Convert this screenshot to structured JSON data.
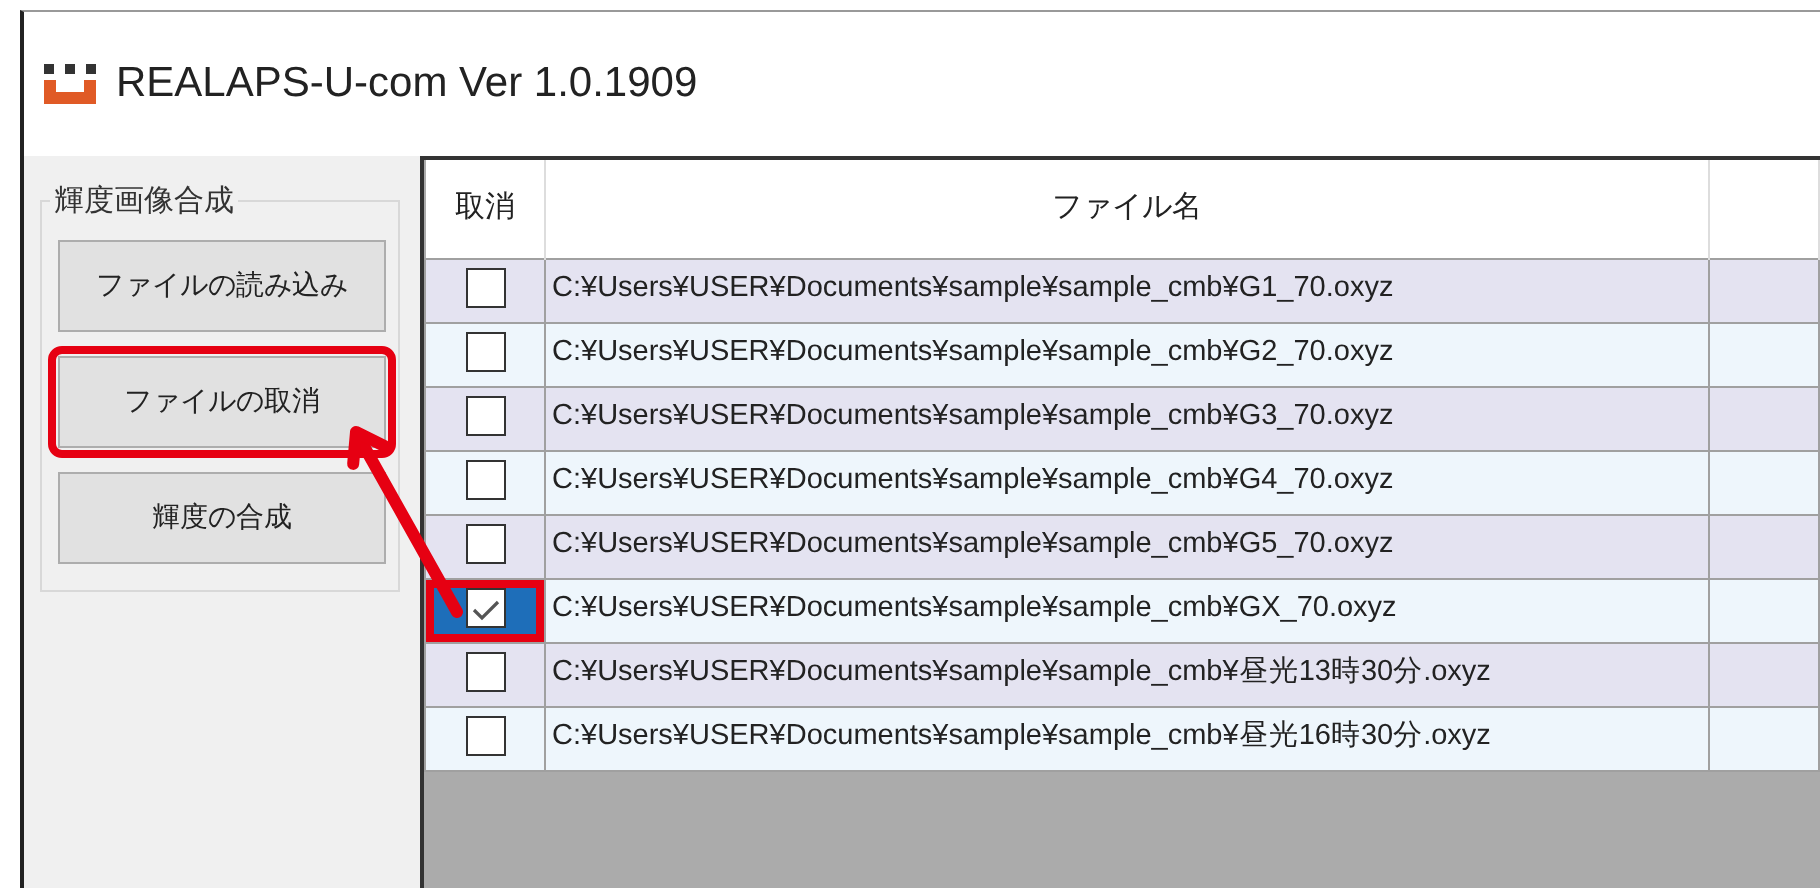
{
  "window": {
    "title": "REALAPS-U-com Ver 1.0.1909"
  },
  "group": {
    "title": "輝度画像合成",
    "buttons": [
      {
        "label": "ファイルの読み込み",
        "highlighted": false
      },
      {
        "label": "ファイルの取消",
        "highlighted": true
      },
      {
        "label": "輝度の合成",
        "highlighted": false
      }
    ]
  },
  "table": {
    "columns": [
      "取消",
      "ファイル名"
    ],
    "rows": [
      {
        "checked": false,
        "selected": false,
        "highlighted": false,
        "file": "C:¥Users¥USER¥Documents¥sample¥sample_cmb¥G1_70.oxyz"
      },
      {
        "checked": false,
        "selected": false,
        "highlighted": false,
        "file": "C:¥Users¥USER¥Documents¥sample¥sample_cmb¥G2_70.oxyz"
      },
      {
        "checked": false,
        "selected": false,
        "highlighted": false,
        "file": "C:¥Users¥USER¥Documents¥sample¥sample_cmb¥G3_70.oxyz"
      },
      {
        "checked": false,
        "selected": false,
        "highlighted": false,
        "file": "C:¥Users¥USER¥Documents¥sample¥sample_cmb¥G4_70.oxyz"
      },
      {
        "checked": false,
        "selected": false,
        "highlighted": false,
        "file": "C:¥Users¥USER¥Documents¥sample¥sample_cmb¥G5_70.oxyz"
      },
      {
        "checked": true,
        "selected": true,
        "highlighted": true,
        "file": "C:¥Users¥USER¥Documents¥sample¥sample_cmb¥GX_70.oxyz"
      },
      {
        "checked": false,
        "selected": false,
        "highlighted": false,
        "file": "C:¥Users¥USER¥Documents¥sample¥sample_cmb¥昼光13時30分.oxyz"
      },
      {
        "checked": false,
        "selected": false,
        "highlighted": false,
        "file": "C:¥Users¥USER¥Documents¥sample¥sample_cmb¥昼光16時30分.oxyz"
      }
    ]
  }
}
